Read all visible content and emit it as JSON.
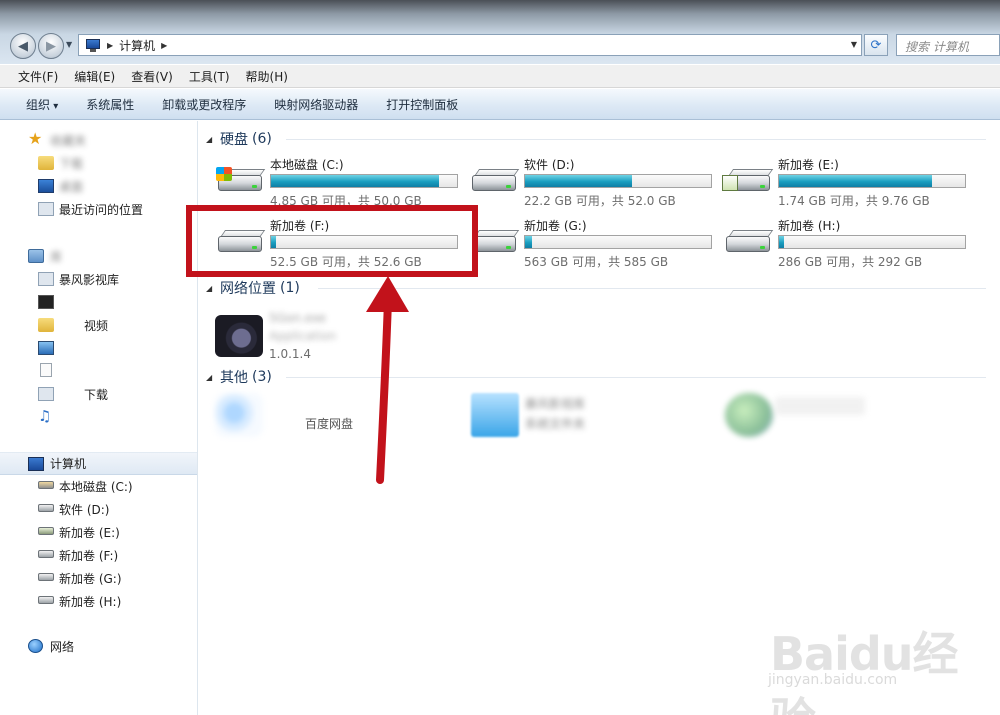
{
  "address": {
    "breadcrumb": "计算机",
    "search_placeholder": "搜索 计算机"
  },
  "menu": [
    "文件(F)",
    "编辑(E)",
    "查看(V)",
    "工具(T)",
    "帮助(H)"
  ],
  "commands": [
    "组织",
    "系统属性",
    "卸载或更改程序",
    "映射网络驱动器",
    "打开控制面板"
  ],
  "sidebar": {
    "favorites": {
      "label": "收藏夹",
      "items": [
        "下载",
        "桌面",
        "最近访问的位置"
      ]
    },
    "libraries": {
      "label": "库",
      "items": [
        "暴风影视库",
        "",
        "视频",
        "",
        "",
        "下载",
        ""
      ]
    },
    "computer": {
      "label": "计算机",
      "items": [
        "本地磁盘 (C:)",
        "软件 (D:)",
        "新加卷 (E:)",
        "新加卷 (F:)",
        "新加卷 (G:)",
        "新加卷 (H:)"
      ]
    },
    "network": {
      "label": "网络"
    }
  },
  "groups": {
    "hard_disks": {
      "title": "硬盘",
      "count": "(6)",
      "drives": [
        {
          "name": "本地磁盘 (C:)",
          "free": "4.85 GB 可用，共 50.0 GB",
          "used_fraction": 0.903
        },
        {
          "name": "软件 (D:)",
          "free": "22.2 GB 可用，共 52.0 GB",
          "used_fraction": 0.573
        },
        {
          "name": "新加卷 (E:)",
          "free": "1.74 GB 可用，共 9.76 GB",
          "used_fraction": 0.822
        },
        {
          "name": "新加卷 (F:)",
          "free": "52.5 GB 可用，共 52.6 GB",
          "used_fraction": 0.002
        },
        {
          "name": "新加卷 (G:)",
          "free": "563 GB 可用，共 585 GB",
          "used_fraction": 0.038
        },
        {
          "name": "新加卷 (H:)",
          "free": "286 GB 可用，共 292 GB",
          "used_fraction": 0.021
        }
      ]
    },
    "network": {
      "title": "网络位置",
      "count": "(1)",
      "item": {
        "name": "5Gon.exe",
        "type": "Application",
        "version": "1.0.1.4"
      }
    },
    "other": {
      "title": "其他",
      "count": "(3)",
      "items": [
        {
          "line1": "",
          "line2": "百度网盘"
        },
        {
          "line1": "暴风影视库",
          "line2": "系统文件夹"
        },
        {
          "line1": "",
          "line2": ""
        }
      ]
    }
  },
  "colors": {
    "highlight_box": "#c2121b",
    "capacity_bar": "#1a9ec0"
  },
  "watermark": {
    "text": "Baidu经验",
    "url": "jingyan.baidu.com"
  }
}
